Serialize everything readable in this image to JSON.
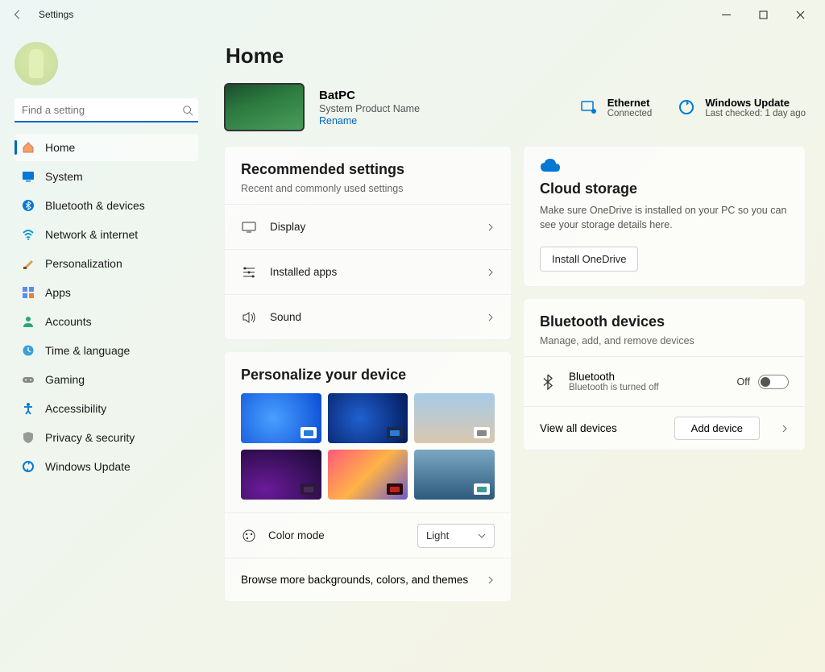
{
  "window": {
    "title": "Settings"
  },
  "search": {
    "placeholder": "Find a setting"
  },
  "nav": [
    {
      "label": "Home",
      "icon": "home",
      "active": true
    },
    {
      "label": "System",
      "icon": "system"
    },
    {
      "label": "Bluetooth & devices",
      "icon": "bluetooth"
    },
    {
      "label": "Network & internet",
      "icon": "wifi"
    },
    {
      "label": "Personalization",
      "icon": "brush"
    },
    {
      "label": "Apps",
      "icon": "apps"
    },
    {
      "label": "Accounts",
      "icon": "person"
    },
    {
      "label": "Time & language",
      "icon": "clock"
    },
    {
      "label": "Gaming",
      "icon": "game"
    },
    {
      "label": "Accessibility",
      "icon": "access"
    },
    {
      "label": "Privacy & security",
      "icon": "shield"
    },
    {
      "label": "Windows Update",
      "icon": "update"
    }
  ],
  "page": {
    "title": "Home"
  },
  "device": {
    "name": "BatPC",
    "subtitle": "System Product Name",
    "rename": "Rename"
  },
  "status": {
    "ethernet": {
      "title": "Ethernet",
      "sub": "Connected"
    },
    "update": {
      "title": "Windows Update",
      "sub": "Last checked: 1 day ago"
    }
  },
  "recommended": {
    "title": "Recommended settings",
    "sub": "Recent and commonly used settings",
    "items": [
      {
        "label": "Display"
      },
      {
        "label": "Installed apps"
      },
      {
        "label": "Sound"
      }
    ]
  },
  "personalize": {
    "title": "Personalize your device",
    "color_mode_label": "Color mode",
    "color_mode_value": "Light",
    "browse": "Browse more backgrounds, colors, and themes"
  },
  "cloud": {
    "title": "Cloud storage",
    "desc": "Make sure OneDrive is installed on your PC so you can see your storage details here.",
    "button": "Install OneDrive"
  },
  "bluetooth": {
    "title": "Bluetooth devices",
    "sub": "Manage, add, and remove devices",
    "toggle_name": "Bluetooth",
    "toggle_sub": "Bluetooth is turned off",
    "toggle_state": "Off",
    "view_all": "View all devices",
    "add": "Add device"
  }
}
